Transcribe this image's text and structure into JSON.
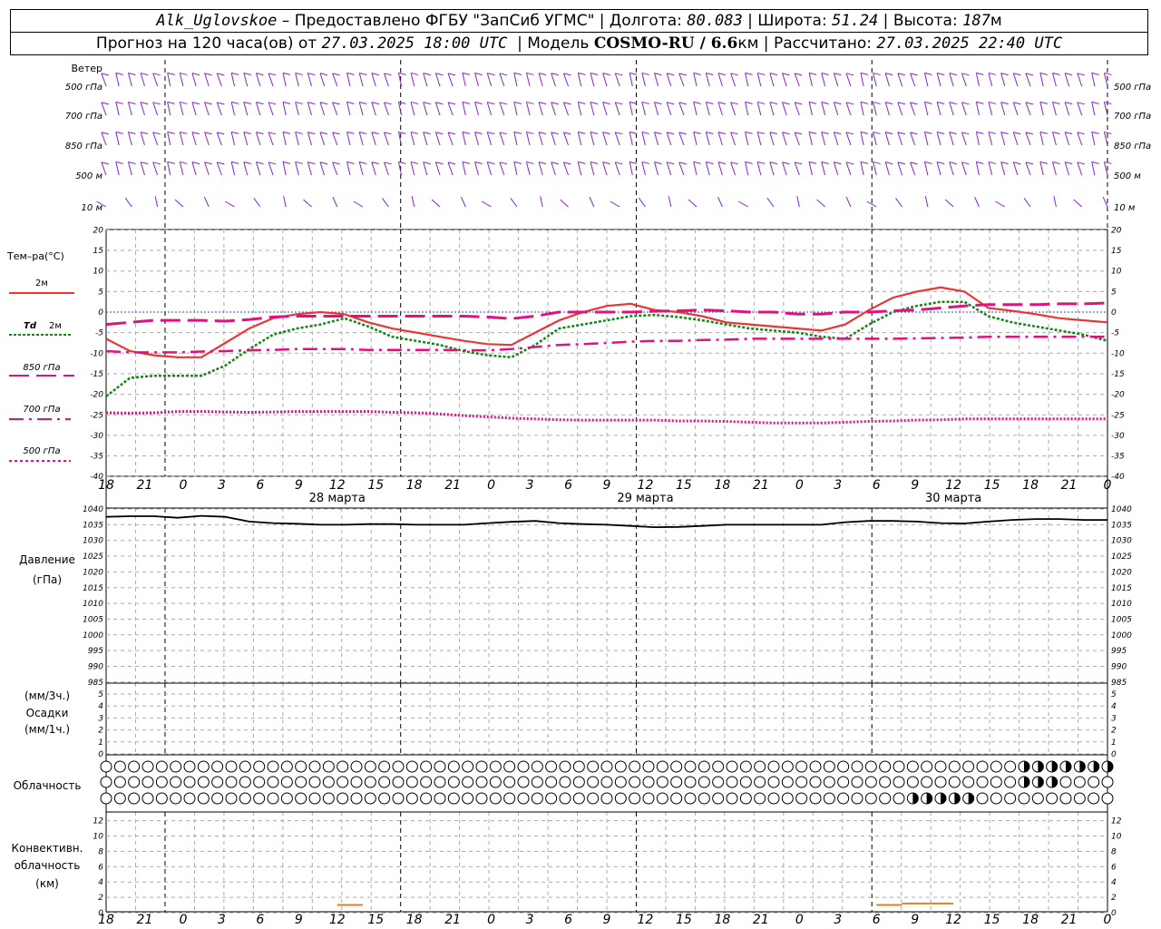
{
  "header": {
    "station": "Alk_Uglovskoe",
    "provider": " – Предоставлено ФГБУ \"ЗапСиб УГМС\" | ",
    "lon_label": "Долгота: ",
    "lon": "80.083",
    "lat_label": " | Широта: ",
    "lat": "51.24",
    "alt_label": " | Высота: ",
    "alt": "187",
    "alt_unit": "м",
    "forecast_label": "Прогноз на 120 часа(ов) от ",
    "forecast_from": "27.03.2025 18:00 UTC",
    "model_label": "  | Модель ",
    "model": "COSMO-RU / 6.6",
    "model_unit": "км",
    "calc_label": " | Рассчитано: ",
    "calc_time": "27.03.2025 22:40 UTC"
  },
  "labels": {
    "wind": "Ветер",
    "levels": [
      "500 гПа",
      "700 гПа",
      "850 гПа",
      "500 м",
      "10  м"
    ],
    "temp": "Тем–ра(°C)",
    "t2m": "2м",
    "td": "Td",
    "td2m": "2м",
    "t850": "850 гПа",
    "t700": "700 гПа",
    "t500": "500 гПа",
    "pressure": "Давление",
    "pressure_unit": "(гПа)",
    "precip_3h": "(мм/3ч.)",
    "precip": "Осадки",
    "precip_1h": "(мм/1ч.)",
    "cloud": "Облачность",
    "conv1": "Конвективн.",
    "conv2": "облачность",
    "conv3": "(км)"
  },
  "axis": {
    "hour_labels": [
      "18",
      "21",
      "0",
      "3",
      "6",
      "9",
      "12",
      "15",
      "18",
      "21",
      "0",
      "3",
      "6",
      "9",
      "12",
      "15",
      "18",
      "21",
      "0",
      "3",
      "6",
      "9",
      "12",
      "15",
      "18",
      "21",
      "0"
    ],
    "dates": [
      "28 марта",
      "29 марта",
      "30 марта"
    ],
    "temp_ticks": [
      "20",
      "15",
      "10",
      "5",
      "0",
      "-5",
      "-10",
      "-15",
      "-20",
      "-25",
      "-30",
      "-35",
      "-40"
    ],
    "pres_ticks": [
      "1040",
      "1035",
      "1030",
      "1025",
      "1020",
      "1015",
      "1010",
      "1005",
      "1000",
      "995",
      "990",
      "985"
    ],
    "precip_ticks": [
      "5",
      "4",
      "3",
      "2",
      "1",
      "0"
    ],
    "conv_ticks": [
      "12",
      "10",
      "8",
      "6",
      "4",
      "2",
      "0"
    ]
  },
  "colors": {
    "t2m": "#ee3333",
    "td": "#118811",
    "t850": "#e0127f",
    "t700": "#e0127f",
    "t500": "#e0127f",
    "wind": "#8822cc",
    "conv": "#e08020",
    "grid": "#aaaaaa"
  },
  "chart_data": [
    {
      "type": "line",
      "title": "Тем–ра(°C)",
      "x_hours": [
        0,
        3,
        6,
        9,
        12,
        15,
        18,
        21,
        24,
        27,
        30,
        33,
        36,
        39,
        42,
        45,
        48,
        51,
        54,
        57,
        60,
        63,
        66,
        69,
        72,
        75,
        78,
        81,
        84,
        87,
        90,
        93,
        96,
        99,
        102,
        105,
        108,
        111,
        114,
        117,
        120
      ],
      "ylim": [
        -40,
        20
      ],
      "series": [
        {
          "name": "2м",
          "values": [
            -6.5,
            -9.5,
            -10.5,
            -11,
            -11,
            -7.5,
            -4,
            -1.5,
            -0.5,
            0,
            -0.5,
            -2.5,
            -4,
            -5,
            -6,
            -7,
            -7.8,
            -8,
            -5,
            -2,
            0,
            1.5,
            2,
            0.5,
            0,
            -1,
            -2.5,
            -3,
            -3.5,
            -4,
            -4.5,
            -3,
            0.5,
            3.5,
            5,
            6,
            5,
            1,
            0.3,
            -0.5,
            -1.5,
            -2,
            -2.5
          ]
        },
        {
          "name": "Td 2м",
          "values": [
            -20.5,
            -16,
            -15.5,
            -15.5,
            -15.5,
            -13,
            -9,
            -5.5,
            -4,
            -3,
            -1.5,
            -3.5,
            -6,
            -7,
            -8,
            -9.5,
            -10.5,
            -11,
            -8,
            -4,
            -3,
            -2,
            -1,
            -0.7,
            -1.2,
            -2,
            -3,
            -4,
            -4.5,
            -5,
            -6,
            -6.5,
            -3,
            0,
            1.5,
            2.5,
            2.5,
            -1,
            -2.5,
            -3.5,
            -4.5,
            -5.5,
            -7
          ]
        },
        {
          "name": "850 гПа",
          "values": [
            -3,
            -2.5,
            -2,
            -2,
            -2,
            -2.2,
            -1.8,
            -1.2,
            -1,
            -1,
            -1,
            -1,
            -1,
            -1,
            -1,
            -1,
            -1.2,
            -1.6,
            -1,
            0,
            0,
            0,
            0,
            0.2,
            0.3,
            0.5,
            0.3,
            0,
            0,
            -0.5,
            -0.5,
            0,
            0,
            0.3,
            0.5,
            1,
            1.5,
            1.8,
            1.8,
            1.8,
            2,
            2,
            2.2
          ]
        },
        {
          "name": "700 гПа",
          "values": [
            -9.5,
            -9.8,
            -9.8,
            -9.8,
            -9.6,
            -9.5,
            -9.3,
            -9.2,
            -9,
            -9,
            -9,
            -9.2,
            -9.2,
            -9.2,
            -9.2,
            -9.3,
            -9.3,
            -9,
            -8.5,
            -8,
            -7.8,
            -7.5,
            -7.2,
            -7,
            -7,
            -6.8,
            -6.7,
            -6.5,
            -6.5,
            -6.5,
            -6.5,
            -6.5,
            -6.5,
            -6.5,
            -6.4,
            -6.3,
            -6.2,
            -6,
            -6,
            -6,
            -6,
            -6,
            -6
          ]
        },
        {
          "name": "500 гПа",
          "values": [
            -24.5,
            -24.6,
            -24.5,
            -24.2,
            -24.2,
            -24.3,
            -24.4,
            -24.3,
            -24.2,
            -24.2,
            -24.2,
            -24.2,
            -24.4,
            -24.5,
            -24.8,
            -25.2,
            -25.5,
            -25.8,
            -26,
            -26.2,
            -26.3,
            -26.3,
            -26.3,
            -26.3,
            -26.5,
            -26.5,
            -26.6,
            -26.8,
            -27,
            -27,
            -27,
            -26.8,
            -26.6,
            -26.5,
            -26.3,
            -26.2,
            -26,
            -26,
            -26,
            -26,
            -26,
            -26,
            -26
          ]
        }
      ]
    },
    {
      "type": "line",
      "title": "Давление (гПа)",
      "x_hours": [
        0,
        3,
        6,
        9,
        12,
        15,
        18,
        21,
        24,
        27,
        30,
        33,
        36,
        39,
        42,
        45,
        48,
        51,
        54,
        57,
        60,
        63,
        66,
        69,
        72,
        75,
        78,
        81,
        84,
        87,
        90,
        93,
        96,
        99,
        102,
        105,
        108,
        111,
        114,
        117,
        120
      ],
      "ylim": [
        985,
        1040
      ],
      "series": [
        {
          "name": "Давление",
          "values": [
            1037.5,
            1037.7,
            1037.7,
            1037.2,
            1037.8,
            1037.5,
            1036,
            1035.5,
            1035.3,
            1035,
            1035,
            1035.2,
            1035.2,
            1035,
            1035,
            1035,
            1035.5,
            1035.9,
            1036.2,
            1035.5,
            1035.2,
            1035,
            1034.6,
            1034.2,
            1034.3,
            1034.6,
            1035,
            1035,
            1035,
            1035,
            1035,
            1035.8,
            1036.2,
            1036.2,
            1036,
            1035.5,
            1035.4,
            1036,
            1036.5,
            1036.8,
            1036.8,
            1036.5,
            1036.5
          ]
        }
      ]
    },
    {
      "type": "bar",
      "title": "Осадки",
      "ylim": [
        0,
        5
      ],
      "values": []
    },
    {
      "type": "bar",
      "title": "Конвективн. облачность (км)",
      "ylim": [
        0,
        13
      ],
      "segments": [
        {
          "from_hour": 18,
          "to_hour": 20,
          "base": 0,
          "top": 1
        },
        {
          "from_hour": 60,
          "to_hour": 62,
          "base": 0,
          "top": 1
        },
        {
          "from_hour": 62,
          "to_hour": 66,
          "base": 0,
          "top": 1.2
        }
      ]
    }
  ]
}
